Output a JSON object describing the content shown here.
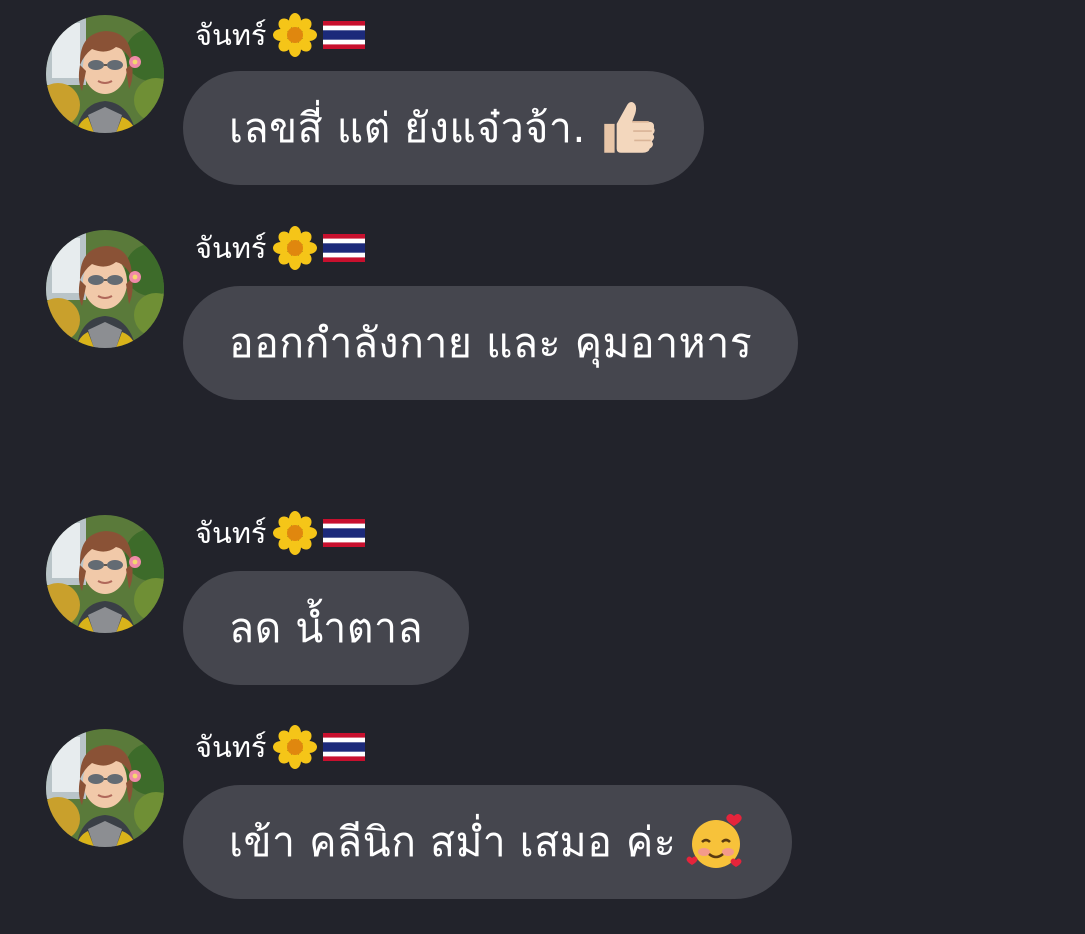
{
  "colors": {
    "background": "#22232b",
    "bubble": "#45464e",
    "text": "#ffffff"
  },
  "messages": [
    {
      "sender": "จันทร์",
      "text": "เลขสี่ แต่ ยังแจ๋วจ้า.",
      "trailing_emoji": "thumbs-up-icon"
    },
    {
      "sender": "จันทร์",
      "text": "ออกกำลังกาย และ คุมอาหาร",
      "trailing_emoji": ""
    },
    {
      "sender": "จันทร์",
      "text": "ลด น้ำตาล",
      "trailing_emoji": ""
    },
    {
      "sender": "จันทร์",
      "text": "เข้า คลีนิก สม่ำ เสมอ ค่ะ",
      "trailing_emoji": "smiling-face-with-hearts-icon"
    }
  ],
  "sender_badges": [
    "blossom-icon",
    "thailand-flag-icon"
  ]
}
